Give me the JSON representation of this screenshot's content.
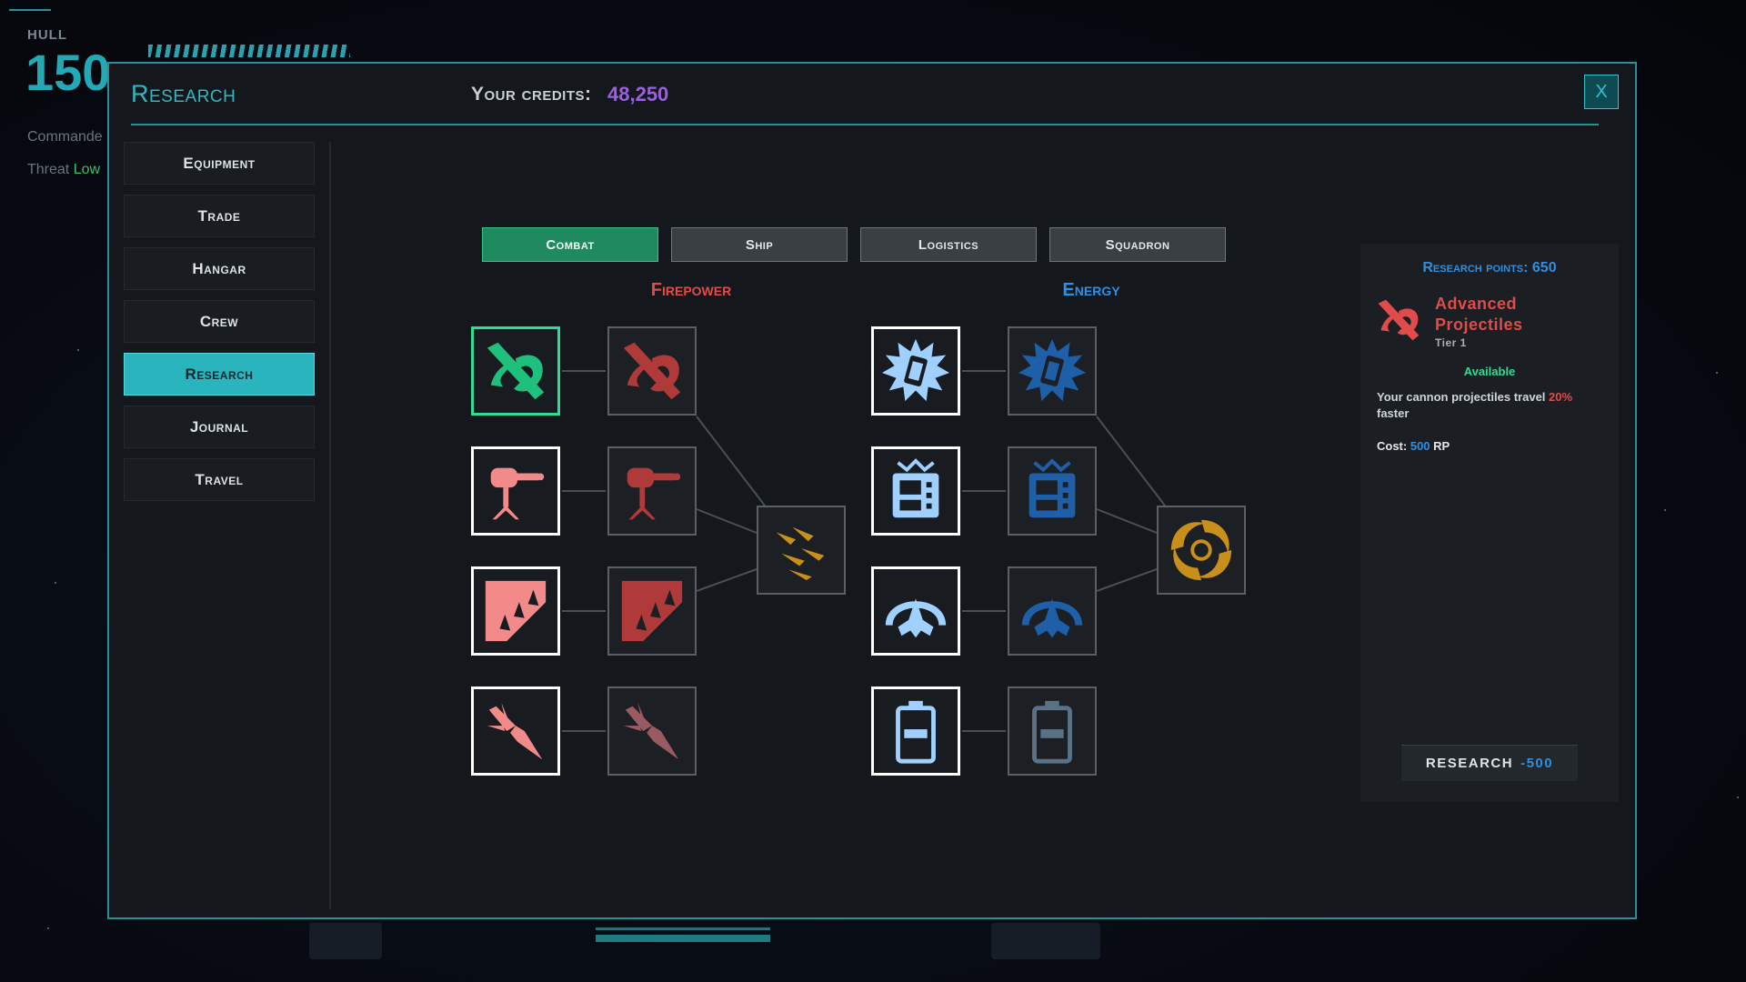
{
  "hud": {
    "hull_label": "HULL",
    "hull_value": "150",
    "commander": "Commande",
    "threat_label": "Threat",
    "threat_level": "Low"
  },
  "modal": {
    "title": "Research",
    "credits_label": "Your credits:",
    "credits_value": "48,250",
    "close_label": "X"
  },
  "nav": [
    {
      "label": "Equipment",
      "active": false
    },
    {
      "label": "Trade",
      "active": false
    },
    {
      "label": "Hangar",
      "active": false
    },
    {
      "label": "Crew",
      "active": false
    },
    {
      "label": "Research",
      "active": true
    },
    {
      "label": "Journal",
      "active": false
    },
    {
      "label": "Travel",
      "active": false
    }
  ],
  "tabs": [
    {
      "label": "Combat",
      "active": true
    },
    {
      "label": "Ship",
      "active": false
    },
    {
      "label": "Logistics",
      "active": false
    },
    {
      "label": "Squadron",
      "active": false
    }
  ],
  "tree": {
    "firepower_label": "Firepower",
    "energy_label": "Energy",
    "colors": {
      "firepower": "#e04b4b",
      "firepower_light": "#f28a8a",
      "energy": "#2f8fe0",
      "energy_light": "#9fd0ff",
      "capstone": "#c8901a",
      "selected": "#2fdc97"
    },
    "firepower_nodes": [
      {
        "icon": "advanced-projectiles-icon",
        "state": "selected"
      },
      {
        "icon": "advanced-projectiles-icon",
        "state": "locked"
      },
      {
        "icon": "turret-icon",
        "state": "unlocked"
      },
      {
        "icon": "turret-icon",
        "state": "locked"
      },
      {
        "icon": "spiked-armor-icon",
        "state": "unlocked"
      },
      {
        "icon": "spiked-armor-icon",
        "state": "locked"
      },
      {
        "icon": "missile-icon",
        "state": "unlocked"
      },
      {
        "icon": "missile-icon",
        "state": "locked"
      },
      {
        "icon": "missile-barrage-icon",
        "state": "capstone"
      }
    ],
    "energy_nodes": [
      {
        "icon": "energy-cell-burst-icon",
        "state": "unlocked"
      },
      {
        "icon": "energy-cell-burst-icon",
        "state": "locked"
      },
      {
        "icon": "generator-icon",
        "state": "unlocked"
      },
      {
        "icon": "generator-icon",
        "state": "locked"
      },
      {
        "icon": "shield-ship-icon",
        "state": "unlocked"
      },
      {
        "icon": "shield-ship-icon",
        "state": "locked"
      },
      {
        "icon": "battery-icon",
        "state": "unlocked"
      },
      {
        "icon": "battery-icon",
        "state": "locked"
      },
      {
        "icon": "vortex-core-icon",
        "state": "capstone"
      }
    ]
  },
  "panel": {
    "rp_label": "Research points:",
    "rp_value": "650",
    "selected_name": "Advanced Projectiles",
    "selected_tier": "Tier 1",
    "status": "Available",
    "desc_before": "Your cannon projectiles travel ",
    "desc_highlight": "20%",
    "desc_after": " faster",
    "cost_label": "Cost:",
    "cost_value": "500",
    "cost_unit": "RP",
    "button_label": "RESEARCH",
    "button_cost": "-500"
  }
}
